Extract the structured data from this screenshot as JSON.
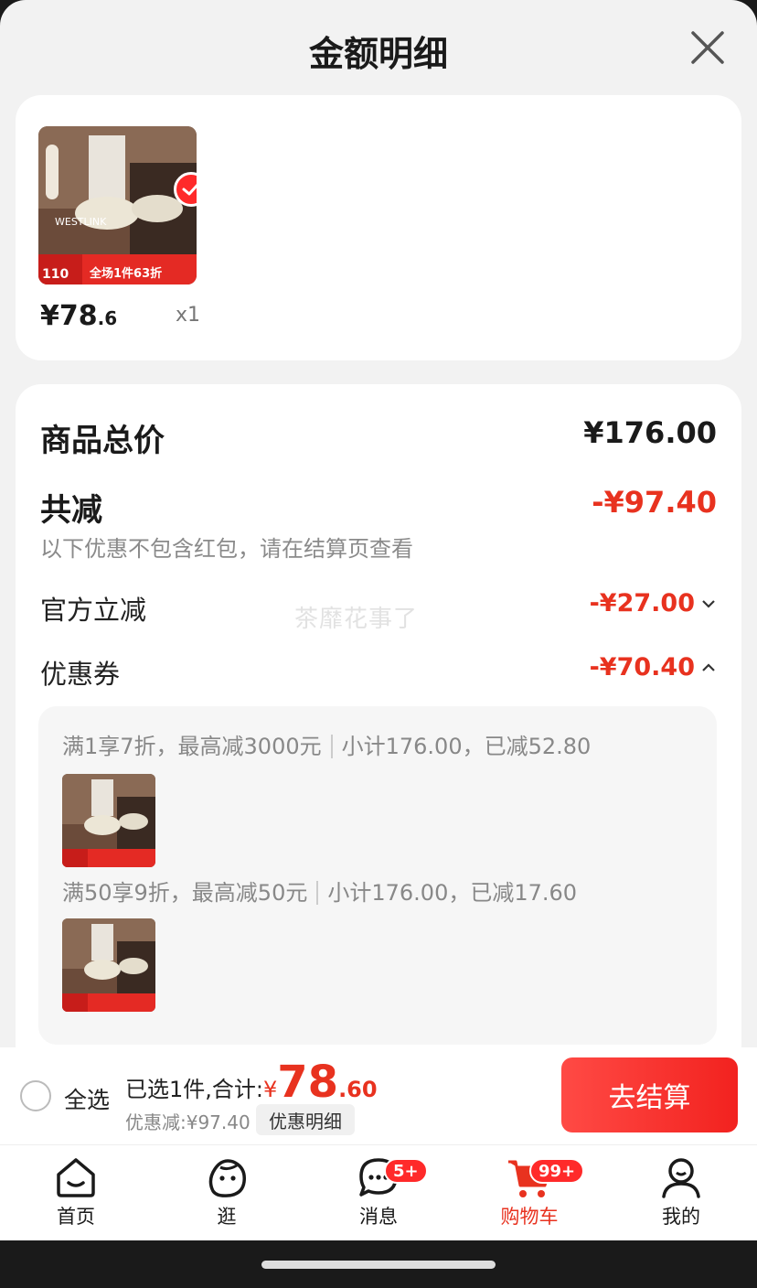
{
  "header": {
    "title": "金额明细"
  },
  "product": {
    "price_int": "¥78",
    "price_dec": ".6",
    "quantity": "x1",
    "image_brand": "WESTLINK",
    "image_promo": "全场1件63折"
  },
  "detail": {
    "total_label": "商品总价",
    "total_value": "¥176.00",
    "reduce_label": "共减",
    "reduce_value": "-¥97.40",
    "reduce_note": "以下优惠不包含红包，请在结算页查看",
    "official_label": "官方立减",
    "official_value": "-¥27.00",
    "coupon_label": "优惠券",
    "coupon_value": "-¥70.40",
    "watermark": "茶靡花事了"
  },
  "coupons": [
    {
      "rule": "满1享7折，最高减3000元",
      "subtotal": "小计176.00，已减52.80"
    },
    {
      "rule": "满50享9折，最高减50元",
      "subtotal": "小计176.00，已减17.60"
    }
  ],
  "checkout": {
    "select_all": "全选",
    "summary_prefix": "已选1件,合计:",
    "yuan": "¥",
    "amount_int": "78",
    "amount_dec": ".60",
    "discount": "优惠减:¥97.40",
    "detail_chip": "优惠明细",
    "button": "去结算"
  },
  "tabs": [
    {
      "label": "首页",
      "icon": "home-icon"
    },
    {
      "label": "逛",
      "icon": "browse-face-icon"
    },
    {
      "label": "消息",
      "icon": "message-icon",
      "badge": "5+"
    },
    {
      "label": "购物车",
      "icon": "cart-icon",
      "badge": "99+",
      "active": true
    },
    {
      "label": "我的",
      "icon": "profile-icon"
    }
  ],
  "colors": {
    "accent": "#e8321f",
    "sheet_bg": "#f2f2f2",
    "badge": "#ff2a2a"
  }
}
